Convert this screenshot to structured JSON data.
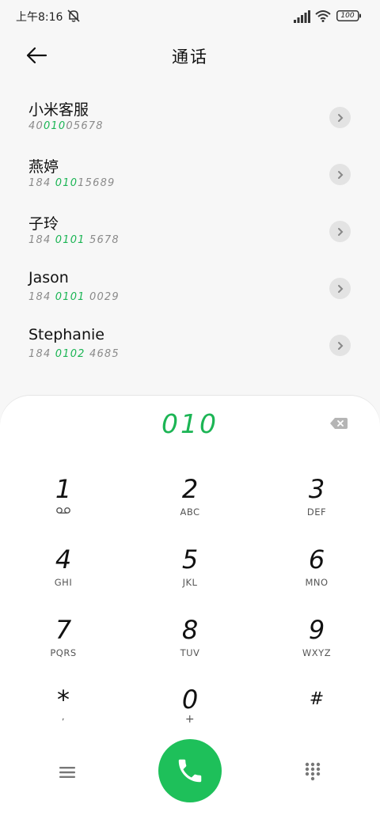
{
  "status_bar": {
    "time": "上午8:16",
    "battery": "100"
  },
  "header": {
    "title": "通话"
  },
  "contacts": [
    {
      "name": "小米客服",
      "number_pre": "40",
      "number_match": "010",
      "number_post": "05678"
    },
    {
      "name": "燕婷",
      "number_pre": "184 ",
      "number_match": "010",
      "number_post": "15689"
    },
    {
      "name": "子玲",
      "number_pre": "184 ",
      "number_match": "0101",
      "number_post": " 5678"
    },
    {
      "name": "Jason",
      "number_pre": "184 ",
      "number_match": "0101",
      "number_post": " 0029"
    },
    {
      "name": "Stephanie",
      "number_pre": "184 ",
      "number_match": "0102",
      "number_post": " 4685"
    }
  ],
  "dialpad": {
    "display": "010",
    "keys": [
      {
        "digit": "1",
        "letters": ""
      },
      {
        "digit": "2",
        "letters": "ABC"
      },
      {
        "digit": "3",
        "letters": "DEF"
      },
      {
        "digit": "4",
        "letters": "GHI"
      },
      {
        "digit": "5",
        "letters": "JKL"
      },
      {
        "digit": "6",
        "letters": "MNO"
      },
      {
        "digit": "7",
        "letters": "PQRS"
      },
      {
        "digit": "8",
        "letters": "TUV"
      },
      {
        "digit": "9",
        "letters": "WXYZ"
      },
      {
        "digit": "*",
        "letters": ","
      },
      {
        "digit": "0",
        "letters": "+"
      },
      {
        "digit": "#",
        "letters": ""
      }
    ]
  },
  "icons": {
    "back": "arrow-left-icon",
    "mute": "bell-off-icon",
    "signal": "signal-icon",
    "wifi": "wifi-icon",
    "battery": "battery-icon",
    "detail": "chevron-right-icon",
    "backspace": "backspace-icon",
    "voicemail": "voicemail-icon",
    "menu": "menu-icon",
    "call": "phone-icon",
    "keypad": "dialpad-icon"
  },
  "colors": {
    "accent": "#1cb555",
    "call_button": "#1ec05a",
    "background": "#f7f7f7",
    "panel": "#ffffff"
  }
}
